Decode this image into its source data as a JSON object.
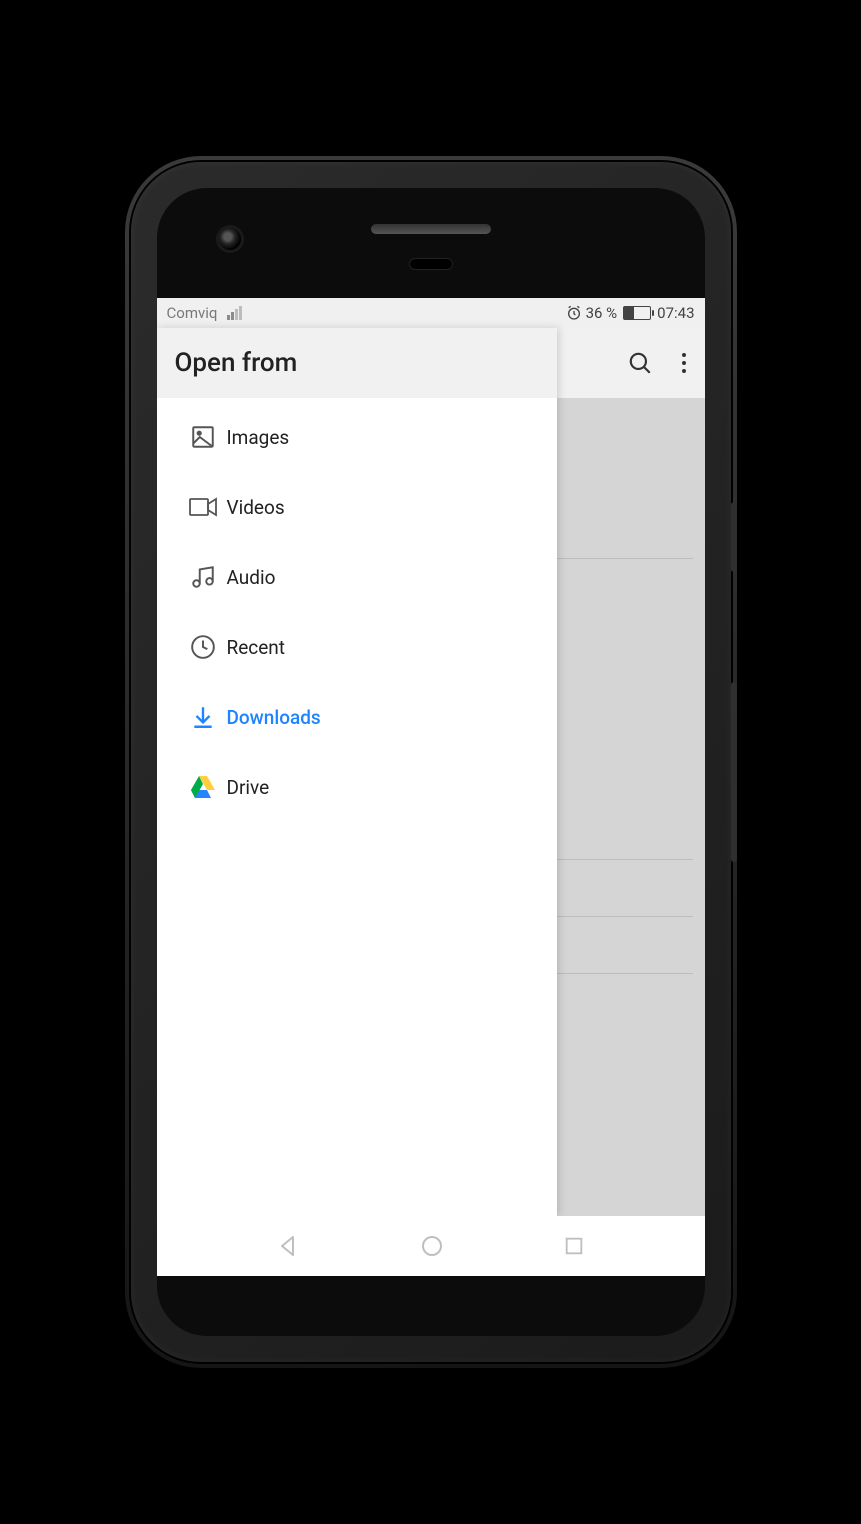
{
  "statusbar": {
    "carrier": "Comviq",
    "battery_pct": "36 %",
    "time": "07:43"
  },
  "page": {
    "toolbar": {
      "search_label": "Search",
      "overflow_label": "More options"
    }
  },
  "drawer": {
    "title": "Open from",
    "items": [
      {
        "icon": "image-icon",
        "label": "Images",
        "active": false
      },
      {
        "icon": "video-icon",
        "label": "Videos",
        "active": false
      },
      {
        "icon": "audio-icon",
        "label": "Audio",
        "active": false
      },
      {
        "icon": "clock-icon",
        "label": "Recent",
        "active": false
      },
      {
        "icon": "download-icon",
        "label": "Downloads",
        "active": true
      },
      {
        "icon": "drive-icon",
        "label": "Drive",
        "active": false
      }
    ]
  },
  "navbar": {
    "back": "Back",
    "home": "Home",
    "recents": "Recents"
  }
}
